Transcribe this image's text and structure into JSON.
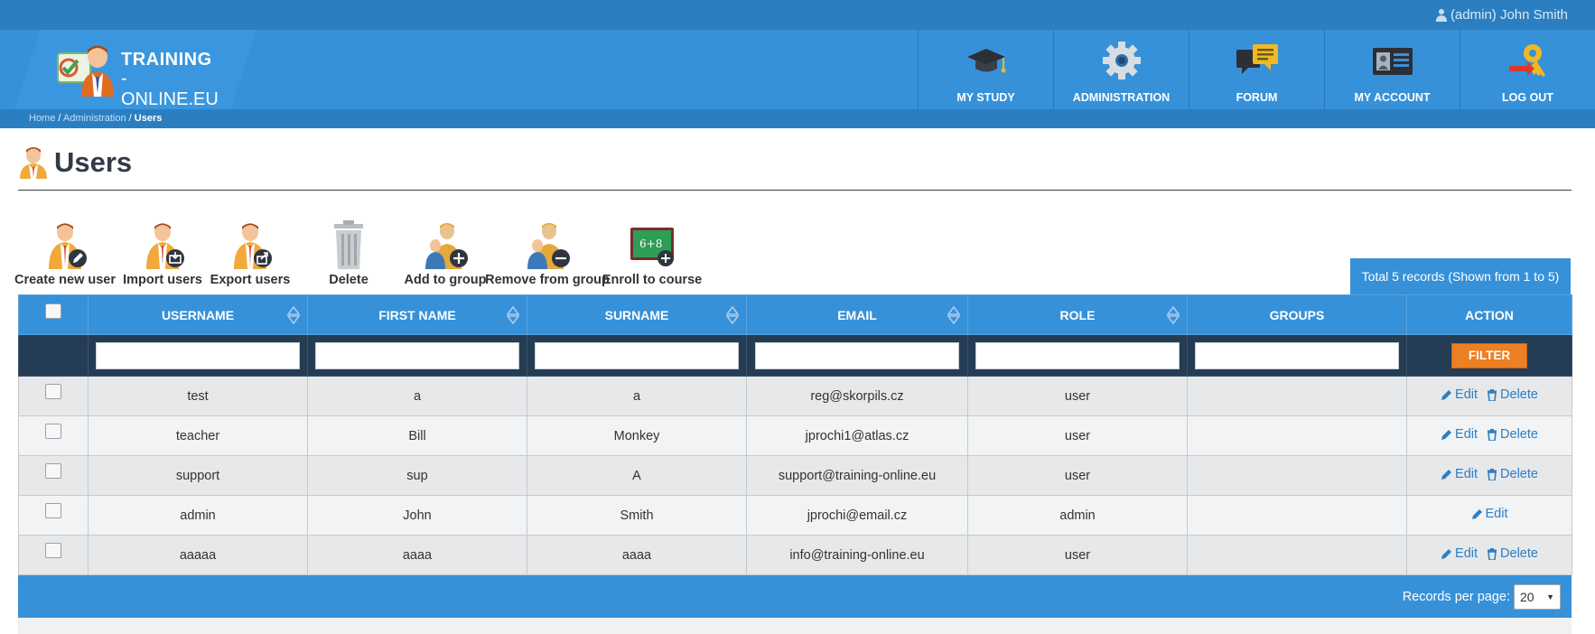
{
  "user": {
    "label": "(admin) John Smith",
    "icon": "user-icon"
  },
  "logo": {
    "line1": "TRAINING",
    "line2": "-ONLINE.EU"
  },
  "nav": [
    {
      "label": "MY STUDY",
      "icon": "graduation-cap-icon"
    },
    {
      "label": "ADMINISTRATION",
      "icon": "gear-icon"
    },
    {
      "label": "FORUM",
      "icon": "chat-bubbles-icon"
    },
    {
      "label": "MY ACCOUNT",
      "icon": "id-card-icon"
    },
    {
      "label": "LOG OUT",
      "icon": "key-exit-icon"
    }
  ],
  "breadcrumb": {
    "home": "Home",
    "sep1": " / ",
    "admin": "Administration",
    "sep2": " / ",
    "current": "Users"
  },
  "page": {
    "title": "Users"
  },
  "toolbar": {
    "create": "Create new user",
    "import": "Import users",
    "export": "Export users",
    "delete": "Delete",
    "add_group": "Add to group",
    "remove_group": "Remove from group",
    "enroll": "Enroll to course",
    "enroll_badge": "6+8"
  },
  "total": "Total 5 records (Shown from 1 to 5)",
  "table": {
    "columns": [
      "USERNAME",
      "FIRST NAME",
      "SURNAME",
      "EMAIL",
      "ROLE",
      "GROUPS",
      "ACTION"
    ],
    "filter_button": "FILTER",
    "edit_label": "Edit",
    "delete_label": "Delete",
    "rows": [
      {
        "username": "test",
        "first": "a",
        "surname": "a",
        "email": "reg@skorpils.cz",
        "role": "user",
        "groups": "",
        "can_delete": true
      },
      {
        "username": "teacher",
        "first": "Bill",
        "surname": "Monkey",
        "email": "jprochi1@atlas.cz",
        "role": "user",
        "groups": "",
        "can_delete": true
      },
      {
        "username": "support",
        "first": "sup",
        "surname": "A",
        "email": "support@training-online.eu",
        "role": "user",
        "groups": "",
        "can_delete": true
      },
      {
        "username": "admin",
        "first": "John",
        "surname": "Smith",
        "email": "jprochi@email.cz",
        "role": "admin",
        "groups": "",
        "can_delete": false
      },
      {
        "username": "aaaaa",
        "first": "aaaa",
        "surname": "aaaa",
        "email": "info@training-online.eu",
        "role": "user",
        "groups": "",
        "can_delete": true
      }
    ]
  },
  "pagination": {
    "label": "Records per page:",
    "value": "20"
  },
  "colors": {
    "primary": "#3691d9",
    "dark": "#2b7fc0",
    "filter_row": "#253c55",
    "accent": "#ec8022",
    "link": "#2e7ec3"
  }
}
